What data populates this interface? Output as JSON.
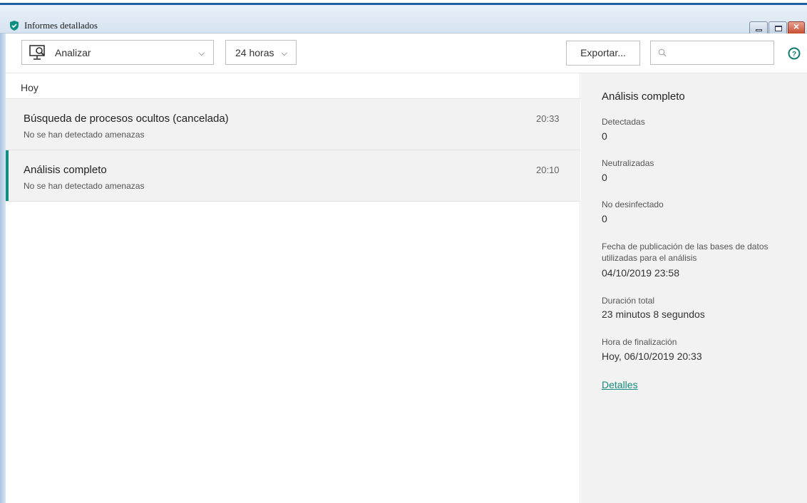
{
  "window": {
    "title": "Informes detallados",
    "app_icon": "shield-check-icon",
    "controls": [
      "minimize-icon",
      "maximize-icon",
      "close-icon"
    ],
    "accent_color": "#0f8f83",
    "titlebar_color": "#1c5fa8"
  },
  "toolbar": {
    "scan_select": {
      "icon": "monitor-scan-icon",
      "value": "Analizar"
    },
    "time_select": {
      "value": "24 horas"
    },
    "export_label": "Exportar...",
    "search": {
      "placeholder": "",
      "value": ""
    },
    "help_icon": "help-circle-icon"
  },
  "list": {
    "group": "Hoy",
    "items": [
      {
        "name": "Búsqueda de procesos ocultos (cancelada)",
        "status": "No se han detectado amenazas",
        "time": "20:33",
        "selected": false
      },
      {
        "name": "Análisis completo",
        "status": "No se han detectado amenazas",
        "time": "20:10",
        "selected": true
      }
    ]
  },
  "details": {
    "title": "Análisis completo",
    "detected_label": "Detectadas",
    "detected_value": "0",
    "neutralized_label": "Neutralizadas",
    "neutralized_value": "0",
    "not_disinfected_label": "No desinfectado",
    "not_disinfected_value": "0",
    "db_date_label": "Fecha de publicación de las bases de datos utilizadas para el análisis",
    "db_date_value": "04/10/2019 23:58",
    "duration_label": "Duración total",
    "duration_value": "23 minutos 8 segundos",
    "end_time_label": "Hora de finalización",
    "end_time_value": "Hoy, 06/10/2019 20:33",
    "details_link": "Detalles"
  }
}
